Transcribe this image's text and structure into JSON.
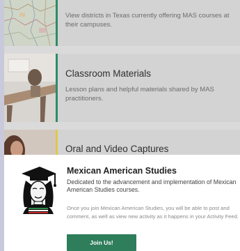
{
  "cards": [
    {
      "title": "",
      "description": "View districts in Texas currently offering MAS courses at their campuses.",
      "accent": "#2e8b6b"
    },
    {
      "title": "Classroom Materials",
      "description": "Lesson plans and helpful materials shared by MAS practitioners.",
      "accent": "#2e8b6b"
    },
    {
      "title": "Oral and Video Captures",
      "description": "",
      "accent": "#e0c84a"
    }
  ],
  "group": {
    "title": "Mexican American Studies",
    "subtitle": "Dedicated to the advancement and implementation of Mexican American Studies courses.",
    "body": "Once you join Mexican American Studies, you will be able to post and comment, as well as view new activity as it happens in your Activity Feed.",
    "join_label": "Join Us!",
    "join_color": "#2e7d5b"
  }
}
